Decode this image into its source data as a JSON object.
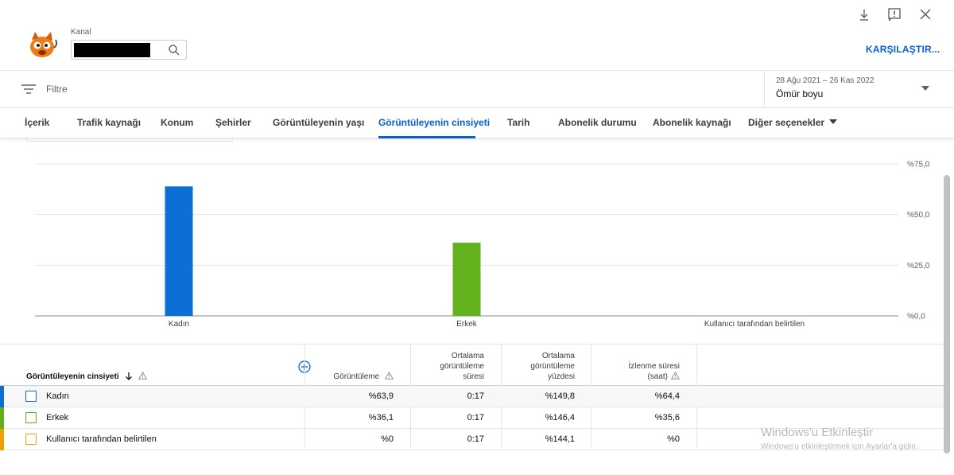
{
  "header": {
    "channel_label": "Kanal",
    "compare_button": "KARŞILAŞTIR..."
  },
  "filter": {
    "label": "Filtre",
    "date_range": "28 Ağu 2021 – 26 Kas 2022",
    "period": "Ömür boyu"
  },
  "tabs": [
    {
      "label": "İçerik"
    },
    {
      "label": "Trafik kaynağı"
    },
    {
      "label": "Konum"
    },
    {
      "label": "Şehirler"
    },
    {
      "label": "Görüntüleyenin yaşı"
    },
    {
      "label": "Görüntüleyenin cinsiyeti",
      "active": true
    },
    {
      "label": "Tarih"
    },
    {
      "label": "Abonelik durumu"
    },
    {
      "label": "Abonelik kaynağı"
    },
    {
      "label": "Diğer seçenekler"
    }
  ],
  "chart_data": {
    "type": "bar",
    "categories": [
      "Kadın",
      "Erkek",
      "Kullanıcı tarafından belirtilen"
    ],
    "values": [
      63.9,
      36.1,
      0
    ],
    "colors": [
      "#0b6fd6",
      "#63b11d",
      "#f29f05"
    ],
    "ylim": [
      0,
      75
    ],
    "yticks": [
      "%0,0",
      "%25,0",
      "%50,0",
      "%75,0"
    ],
    "ytick_values": [
      0,
      25,
      50,
      75
    ],
    "grid": true,
    "title": "",
    "xlabel": "",
    "ylabel": ""
  },
  "table": {
    "dimension_header": "Görüntüleyenin cinsiyeti",
    "columns": {
      "views": "Görüntüleme",
      "avg_duration": [
        "Ortalama",
        "görüntüleme",
        "süresi"
      ],
      "avg_percent": [
        "Ortalama",
        "görüntüleme",
        "yüzdesi"
      ],
      "watch_time": [
        "İzlenme süresi",
        "(saat)"
      ]
    },
    "rows": [
      {
        "label": "Kadın",
        "color": "#0b6fd6",
        "views": "%63,9",
        "avg_duration": "0:17",
        "avg_percent": "%149,8",
        "watch_time": "%64,4"
      },
      {
        "label": "Erkek",
        "color": "#63b11d",
        "views": "%36,1",
        "avg_duration": "0:17",
        "avg_percent": "%146,4",
        "watch_time": "%35,6"
      },
      {
        "label": "Kullanıcı tarafından belirtilen",
        "color": "#f29f05",
        "views": "%0",
        "avg_duration": "0:17",
        "avg_percent": "%144,1",
        "watch_time": "%0"
      }
    ]
  },
  "watermark": {
    "title": "Windows'u Etkinleştir",
    "subtitle": "Windows'u etkinleştirmek için Ayarlar'a gidin."
  },
  "icons": {
    "download": "download-icon",
    "feedback": "feedback-icon",
    "close": "close-icon",
    "search": "search-icon",
    "filter": "filter-icon",
    "add": "add-column-icon",
    "warning": "warning-icon",
    "sort": "sort-down-icon"
  }
}
